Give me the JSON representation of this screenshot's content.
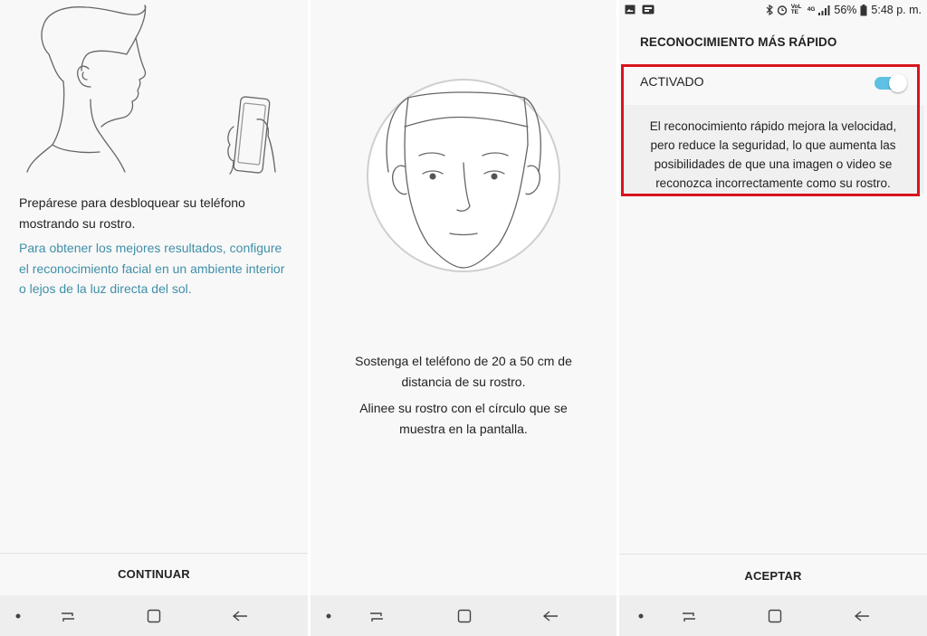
{
  "panel1": {
    "instruction": "Prepárese para desbloquear su teléfono mostrando su rostro.",
    "hint": "Para obtener los mejores resultados, configure el reconocimiento facial en un ambiente interior o lejos de la luz directa del sol.",
    "button": "CONTINUAR"
  },
  "panel2": {
    "distance_text": "Sostenga el teléfono de 20 a 50 cm de distancia de su rostro.",
    "align_text": "Alinee su rostro con el círculo que se muestra en la pantalla."
  },
  "panel3": {
    "status": {
      "battery": "56%",
      "time": "5:48 p. m.",
      "volte": "VoLTE",
      "network": "4G"
    },
    "title": "RECONOCIMIENTO MÁS RÁPIDO",
    "toggle_label": "ACTIVADO",
    "toggle_on": true,
    "description": "El reconocimiento rápido mejora la velocidad, pero reduce la seguridad, lo que aumenta las posibilidades de que una imagen o video se reconozca incorrectamente como su rostro.",
    "button": "ACEPTAR"
  },
  "icons": {
    "nav": [
      "nav-dot-icon",
      "recent-apps-icon",
      "home-icon",
      "back-icon"
    ],
    "status": [
      "gallery-icon",
      "notification-icon",
      "bluetooth-icon",
      "alarm-icon",
      "signal-icon",
      "battery-icon"
    ]
  },
  "colors": {
    "accent_link": "#3f8fa8",
    "toggle_on": "#5ec1e3",
    "highlight_border": "#d9141d"
  }
}
